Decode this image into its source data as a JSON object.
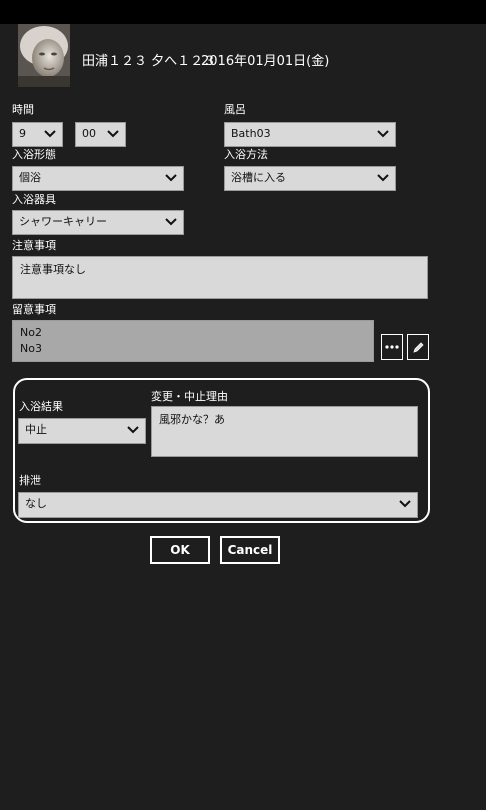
{
  "header": {
    "title": "田浦１２３ 夕へ１２３",
    "date": "2016年01月01日(金)"
  },
  "time": {
    "label": "時間",
    "hour": "9",
    "minute": "00"
  },
  "bath": {
    "label": "風呂",
    "value": "Bath03"
  },
  "bathing_form": {
    "label": "入浴形態",
    "value": "個浴"
  },
  "bathing_method": {
    "label": "入浴方法",
    "value": "浴槽に入る"
  },
  "bathing_equipment": {
    "label": "入浴器具",
    "value": "シャワーキャリー"
  },
  "caution": {
    "label": "注意事項",
    "value": "注意事項なし"
  },
  "notes": {
    "label": "留意事項",
    "items": [
      "No2",
      "No3"
    ]
  },
  "result_panel": {
    "result_label": "入浴結果",
    "result_value": "中止",
    "reason_label": "変更・中止理由",
    "reason_value": "風邪かな？あ",
    "excretion_label": "排泄",
    "excretion_value": "なし"
  },
  "buttons": {
    "ok": "OK",
    "cancel": "Cancel"
  }
}
